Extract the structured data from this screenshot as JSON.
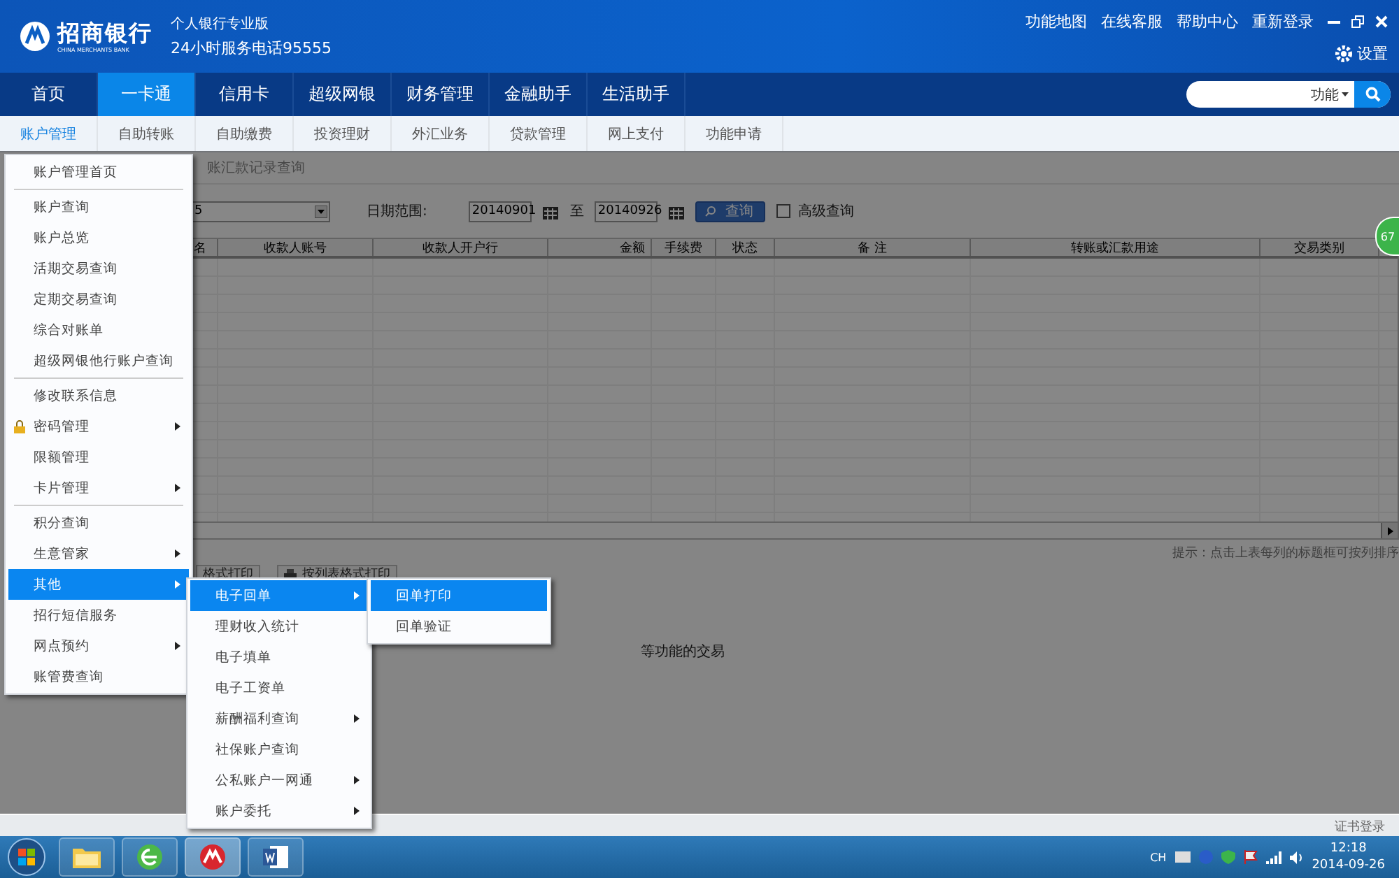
{
  "header": {
    "logo_text": "招商银行",
    "logo_subtext": "CHINA MERCHANTS BANK",
    "edition": "个人银行专业版",
    "hotline": "24小时服务电话95555",
    "links": [
      "功能地图",
      "在线客服",
      "帮助中心",
      "重新登录"
    ],
    "settings": "设置",
    "search": {
      "scope": "功能"
    }
  },
  "nav": [
    {
      "label": "首页",
      "selected": false
    },
    {
      "label": "一卡通",
      "selected": true
    },
    {
      "label": "信用卡",
      "selected": false
    },
    {
      "label": "超级网银",
      "selected": false
    },
    {
      "label": "财务管理",
      "selected": false
    },
    {
      "label": "金融助手",
      "selected": false
    },
    {
      "label": "生活助手",
      "selected": false
    }
  ],
  "subnav": [
    {
      "label": "账户管理",
      "selected": true
    },
    {
      "label": "自助转账",
      "selected": false
    },
    {
      "label": "自助缴费",
      "selected": false
    },
    {
      "label": "投资理财",
      "selected": false
    },
    {
      "label": "外汇业务",
      "selected": false
    },
    {
      "label": "贷款管理",
      "selected": false
    },
    {
      "label": "网上支付",
      "selected": false
    },
    {
      "label": "功能申请",
      "selected": false
    }
  ],
  "page": {
    "title": "账汇款记录查询",
    "account_value": "5",
    "date_label": "日期范围:",
    "date_from": "20140901",
    "to_label": "至",
    "date_to": "20140926",
    "query_button": "查询",
    "advanced": {
      "label": "高级查询",
      "checked": false
    },
    "columns": [
      "名",
      "收款人账号",
      "收款人开户行",
      "金额",
      "手续费",
      "状态",
      "备 注",
      "转账或汇款用途",
      "交易类别"
    ],
    "hint": "提示：点击上表每列的标题框可按列排序",
    "print_buttons": [
      "格式打印",
      "按列表格式打印"
    ],
    "note": "等功能的交易",
    "status_bar": "证书登录",
    "badge": "67"
  },
  "menus": [
    {
      "items": [
        {
          "kind": "entry",
          "label": "账户管理首页",
          "submenu": false,
          "selected": false
        },
        {
          "kind": "separator"
        },
        {
          "kind": "entry",
          "label": "账户查询",
          "submenu": false,
          "selected": false
        },
        {
          "kind": "entry",
          "label": "账户总览",
          "submenu": false,
          "selected": false
        },
        {
          "kind": "entry",
          "label": "活期交易查询",
          "submenu": false,
          "selected": false
        },
        {
          "kind": "entry",
          "label": "定期交易查询",
          "submenu": false,
          "selected": false
        },
        {
          "kind": "entry",
          "label": "综合对账单",
          "submenu": false,
          "selected": false
        },
        {
          "kind": "entry",
          "label": "超级网银他行账户查询",
          "submenu": false,
          "selected": false
        },
        {
          "kind": "separator"
        },
        {
          "kind": "entry",
          "label": "修改联系信息",
          "submenu": false,
          "selected": false
        },
        {
          "kind": "icon_entry",
          "label": "密码管理",
          "submenu": true,
          "selected": false
        },
        {
          "kind": "entry",
          "label": "限额管理",
          "submenu": false,
          "selected": false
        },
        {
          "kind": "entry",
          "label": "卡片管理",
          "submenu": true,
          "selected": false
        },
        {
          "kind": "separator"
        },
        {
          "kind": "entry",
          "label": "积分查询",
          "submenu": false,
          "selected": false
        },
        {
          "kind": "entry",
          "label": "生意管家",
          "submenu": true,
          "selected": false
        },
        {
          "kind": "entry",
          "label": "其他",
          "submenu": true,
          "selected": true
        },
        {
          "kind": "entry",
          "label": "招行短信服务",
          "submenu": false,
          "selected": false
        },
        {
          "kind": "entry",
          "label": "网点预约",
          "submenu": true,
          "selected": false
        },
        {
          "kind": "entry",
          "label": "账管费查询",
          "submenu": false,
          "selected": false
        }
      ]
    },
    {
      "items": [
        {
          "kind": "entry",
          "label": "电子回单",
          "submenu": true,
          "selected": true
        },
        {
          "kind": "entry",
          "label": "理财收入统计",
          "submenu": false,
          "selected": false
        },
        {
          "kind": "entry",
          "label": "电子填单",
          "submenu": false,
          "selected": false
        },
        {
          "kind": "entry",
          "label": "电子工资单",
          "submenu": false,
          "selected": false
        },
        {
          "kind": "entry",
          "label": "薪酬福利查询",
          "submenu": true,
          "selected": false
        },
        {
          "kind": "entry",
          "label": "社保账户查询",
          "submenu": false,
          "selected": false
        },
        {
          "kind": "entry",
          "label": "公私账户一网通",
          "submenu": true,
          "selected": false
        },
        {
          "kind": "entry",
          "label": "账户委托",
          "submenu": true,
          "selected": false
        }
      ]
    },
    {
      "items": [
        {
          "kind": "entry",
          "label": "回单打印",
          "submenu": false,
          "selected": true
        },
        {
          "kind": "entry",
          "label": "回单验证",
          "submenu": false,
          "selected": false
        }
      ]
    }
  ],
  "taskbar": {
    "apps": [
      {
        "kind": "folder",
        "selected": false
      },
      {
        "kind": "browser",
        "selected": false
      },
      {
        "kind": "bank",
        "selected": true
      },
      {
        "kind": "word",
        "selected": false
      }
    ],
    "tray_lang": "CH",
    "time": "12:18",
    "date": "2014-09-26"
  }
}
